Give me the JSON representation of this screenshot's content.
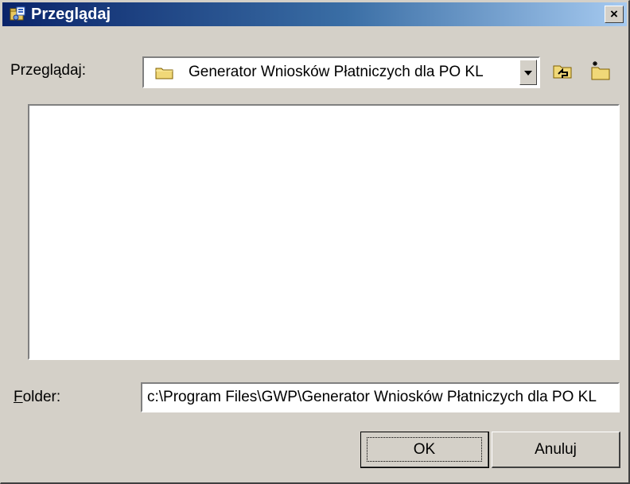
{
  "window": {
    "title": "Przeglądaj",
    "close_glyph": "×",
    "icon": "folder-search-icon"
  },
  "lookin": {
    "label": "Przeglądaj:",
    "value": "Generator Wniosków Płatniczych dla PO KL",
    "folder_icon": "folder-icon",
    "dropdown_icon": "chevron-down-icon"
  },
  "toolbar": {
    "up_icon": "up-one-level-icon",
    "new_folder_icon": "new-folder-icon"
  },
  "folder": {
    "label_accel": "F",
    "label_rest": "older:",
    "value": "c:\\Program Files\\GWP\\Generator Wniosków Płatniczych dla PO KL"
  },
  "buttons": {
    "ok": "OK",
    "cancel": "Anuluj"
  },
  "colors": {
    "face": "#d4d0c8",
    "title_start": "#0a246a",
    "title_end": "#a6caf0"
  }
}
